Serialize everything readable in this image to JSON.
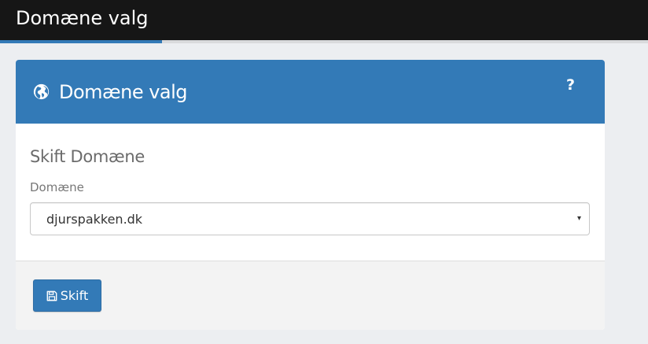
{
  "topbar": {
    "title": "Domæne valg"
  },
  "progress": {
    "fraction": 0.25
  },
  "panel": {
    "title": "Domæne valg",
    "globe_icon": "globe-icon",
    "help_icon_label": "?",
    "section_title": "Skift Domæne",
    "field_label": "Domæne",
    "select": {
      "selected": "djurspakken.dk",
      "caret": "▾"
    },
    "button_label": "Skift",
    "button_icon": "save-icon"
  },
  "colors": {
    "topbar": "#161616",
    "accent": "#337ab7",
    "page_background": "#eceef1"
  }
}
